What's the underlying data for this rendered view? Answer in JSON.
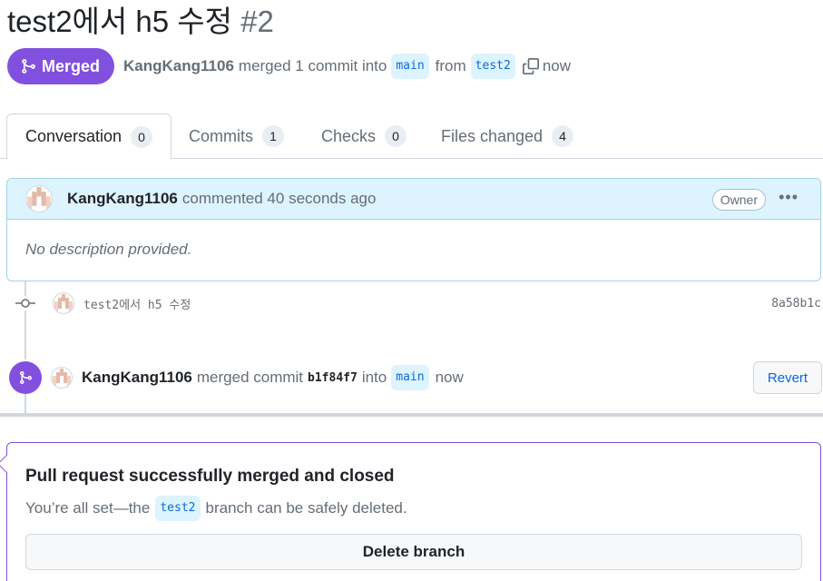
{
  "pr": {
    "title": "test2에서 h5 수정",
    "number": "#2",
    "state": "Merged",
    "author": "KangKang1106",
    "summary_text": "merged 1 commit into",
    "base_branch": "main",
    "from_text": "from",
    "head_branch": "test2",
    "time": "now"
  },
  "tabs": [
    {
      "label": "Conversation",
      "count": "0"
    },
    {
      "label": "Commits",
      "count": "1"
    },
    {
      "label": "Checks",
      "count": "0"
    },
    {
      "label": "Files changed",
      "count": "4"
    }
  ],
  "comment": {
    "author": "KangKang1106",
    "action": "commented 40 seconds ago",
    "badge": "Owner",
    "body": "No description provided."
  },
  "commit": {
    "message": "test2에서 h5 수정",
    "sha": "8a58b1c"
  },
  "merge_event": {
    "author": "KangKang1106",
    "text1": "merged commit",
    "sha": "b1f84f7",
    "text2": "into",
    "branch": "main",
    "time": "now",
    "revert_label": "Revert"
  },
  "merged_box": {
    "title": "Pull request successfully merged and closed",
    "desc_before": "You’re all set—the",
    "branch": "test2",
    "desc_after": "branch can be safely deleted.",
    "delete_label": "Delete branch"
  },
  "colors": {
    "merged_purple": "#8250df",
    "branch_bg": "#ddf4ff",
    "link_blue": "#0969da"
  }
}
